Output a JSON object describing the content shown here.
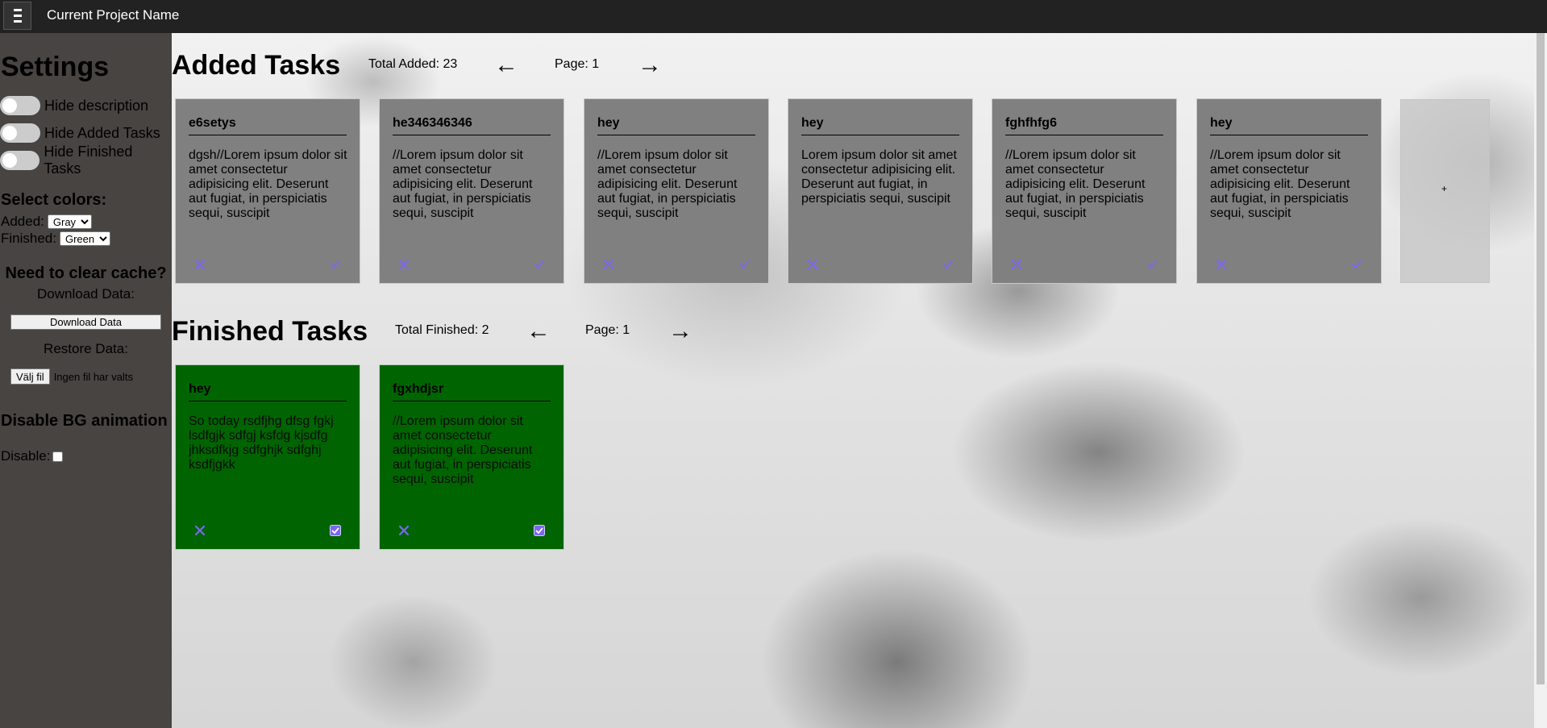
{
  "topbar": {
    "project_name": "Current Project Name",
    "menu_icon": "hamburger-icon"
  },
  "sidebar": {
    "title": "Settings",
    "toggles": [
      {
        "label": "Hide description"
      },
      {
        "label": "Hide Added Tasks"
      },
      {
        "label": "Hide Finished Tasks"
      }
    ],
    "colors_heading": "Select colors:",
    "added_label": "Added:",
    "added_value": "Gray",
    "finished_label": "Finished:",
    "finished_value": "Green",
    "cache_heading": "Need to clear cache?",
    "download_label": "Download Data:",
    "download_button": "Download Data",
    "restore_label": "Restore Data:",
    "file_button": "Välj fil",
    "file_status": "Ingen fil har valts",
    "bg_heading": "Disable BG animation",
    "disable_label": "Disable:"
  },
  "added": {
    "title": "Added Tasks",
    "total": "Total Added: 23",
    "page": "Page: 1",
    "prev_arrow": "←",
    "next_arrow": "→",
    "add_symbol": "+",
    "cards": [
      {
        "title": "e6setys",
        "desc": "dgsh//Lorem ipsum dolor sit amet consectetur adipisicing elit. Deserunt aut fugiat, in perspiciatis sequi, suscipit"
      },
      {
        "title": "he346346346",
        "desc": "//Lorem ipsum dolor sit amet consectetur adipisicing elit. Deserunt aut fugiat, in perspiciatis sequi, suscipit"
      },
      {
        "title": "hey",
        "desc": "//Lorem ipsum dolor sit amet consectetur adipisicing elit. Deserunt aut fugiat, in perspiciatis sequi, suscipit"
      },
      {
        "title": "hey",
        "desc": "Lorem ipsum dolor sit amet consectetur adipisicing elit. Deserunt aut fugiat, in perspiciatis sequi, suscipit"
      },
      {
        "title": "fghfhfg6",
        "desc": "//Lorem ipsum dolor sit amet consectetur adipisicing elit. Deserunt aut fugiat, in perspiciatis sequi, suscipit"
      },
      {
        "title": "hey",
        "desc": "//Lorem ipsum dolor sit amet consectetur adipisicing elit. Deserunt aut fugiat, in perspiciatis sequi, suscipit"
      }
    ]
  },
  "finished": {
    "title": "Finished Tasks",
    "total": "Total Finished: 2",
    "page": "Page: 1",
    "prev_arrow": "←",
    "next_arrow": "→",
    "cards": [
      {
        "title": "hey",
        "desc": "So today rsdfjhg dfsg fgkj lsdfgjk sdfgj ksfdg kjsdfg jhksdfkjg sdfghjk sdfghj ksdfjgkk"
      },
      {
        "title": "fgxhdjsr",
        "desc": "//Lorem ipsum dolor sit amet consectetur adipisicing elit. Deserunt aut fugiat, in perspiciatis sequi, suscipit"
      }
    ]
  },
  "colors": {
    "topbar": "#222222",
    "sidebar": "#474442",
    "added_card": "#808080",
    "finished_card": "#006400",
    "icon_accent": "#7b68ee"
  }
}
